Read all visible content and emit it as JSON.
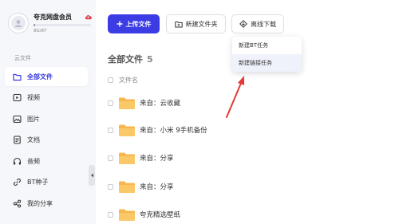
{
  "user": {
    "name": "夸克网盘会员",
    "storage": "8G/6T",
    "storage_used_fraction": 0.0013
  },
  "sidebar": {
    "section_title": "云文件",
    "items": [
      {
        "label": "全部文件",
        "icon": "folder-icon",
        "active": true
      },
      {
        "label": "视频",
        "icon": "video-icon"
      },
      {
        "label": "图片",
        "icon": "image-icon"
      },
      {
        "label": "文档",
        "icon": "document-icon"
      },
      {
        "label": "音频",
        "icon": "headphones-icon"
      },
      {
        "label": "BT种子",
        "icon": "link-icon"
      },
      {
        "label": "我的分享",
        "icon": "share-icon"
      }
    ]
  },
  "toolbar": {
    "upload_label": "上传文件",
    "new_folder_label": "新建文件夹",
    "offline_label": "离线下载"
  },
  "dropdown": {
    "items": [
      "新建BT任务",
      "新建链接任务"
    ]
  },
  "main": {
    "title": "全部文件",
    "count": "5",
    "column_name": "文件名",
    "files": [
      "来自：云收藏",
      "来自：小米 9手机备份",
      "来自：分享",
      "来自：分享",
      "夸克精选壁纸"
    ]
  },
  "colors": {
    "accent": "#3b3ce3",
    "folder": "#f8b64c",
    "arrow": "#e53935"
  }
}
